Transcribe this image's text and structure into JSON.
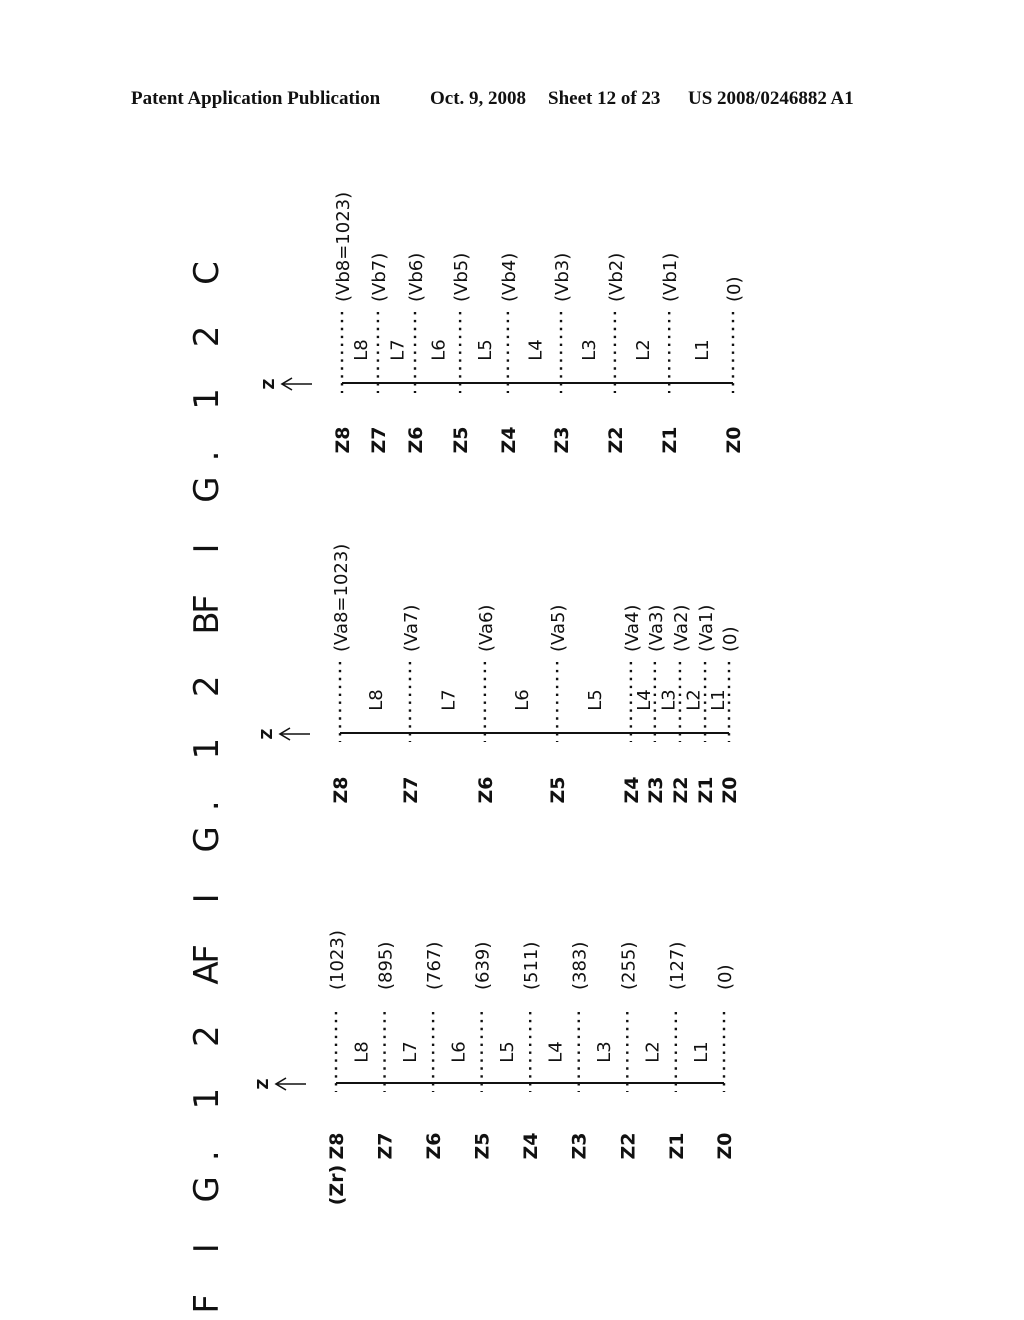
{
  "header": {
    "publication": "Patent Application Publication",
    "date": "Oct. 9, 2008",
    "sheet": "Sheet 12 of 23",
    "number": "US 2008/0246882 A1"
  },
  "axis_symbol": "Z",
  "figures": [
    {
      "id": "12A",
      "title": "F I G. 1 2 A",
      "extra_label": "(Zr)",
      "z_labels": [
        "Z8",
        "Z7",
        "Z6",
        "Z5",
        "Z4",
        "Z3",
        "Z2",
        "Z1",
        "Z0"
      ],
      "layer_labels": [
        "L8",
        "L7",
        "L6",
        "L5",
        "L4",
        "L3",
        "L2",
        "L1"
      ],
      "value_labels": [
        "(1023)",
        "(895)",
        "(767)",
        "(639)",
        "(511)",
        "(383)",
        "(255)",
        "(127)",
        "(0)"
      ],
      "boundaries": [
        1023,
        895,
        767,
        639,
        511,
        383,
        255,
        127,
        0
      ]
    },
    {
      "id": "12B",
      "title": "F I G. 1 2 B",
      "extra_label": "",
      "z_labels": [
        "Z8",
        "Z7",
        "Z6",
        "Z5",
        "Z4",
        "Z3",
        "Z2",
        "Z1",
        "Z0"
      ],
      "layer_labels": [
        "L8",
        "L7",
        "L6",
        "L5",
        "L4",
        "L3",
        "L2",
        "L1"
      ],
      "value_labels": [
        "(Va8=1023)",
        "(Va7)",
        "(Va6)",
        "(Va5)",
        "(Va4)",
        "(Va3)",
        "(Va2)",
        "(Va1)",
        "(0)"
      ],
      "boundaries": [
        1023,
        839,
        642,
        452,
        258,
        195,
        129,
        63,
        0
      ]
    },
    {
      "id": "12C",
      "title": "F I G. 1 2 C",
      "extra_label": "",
      "z_labels": [
        "Z8",
        "Z7",
        "Z6",
        "Z5",
        "Z4",
        "Z3",
        "Z2",
        "Z1",
        "Z0"
      ],
      "layer_labels": [
        "L8",
        "L7",
        "L6",
        "L5",
        "L4",
        "L3",
        "L2",
        "L1"
      ],
      "value_labels": [
        "(Vb8=1023)",
        "(Vb7)",
        "(Vb6)",
        "(Vb5)",
        "(Vb4)",
        "(Vb3)",
        "(Vb2)",
        "(Vb1)",
        "(0)"
      ],
      "boundaries": [
        1023,
        929,
        832,
        714,
        589,
        450,
        309,
        167,
        0
      ]
    }
  ]
}
